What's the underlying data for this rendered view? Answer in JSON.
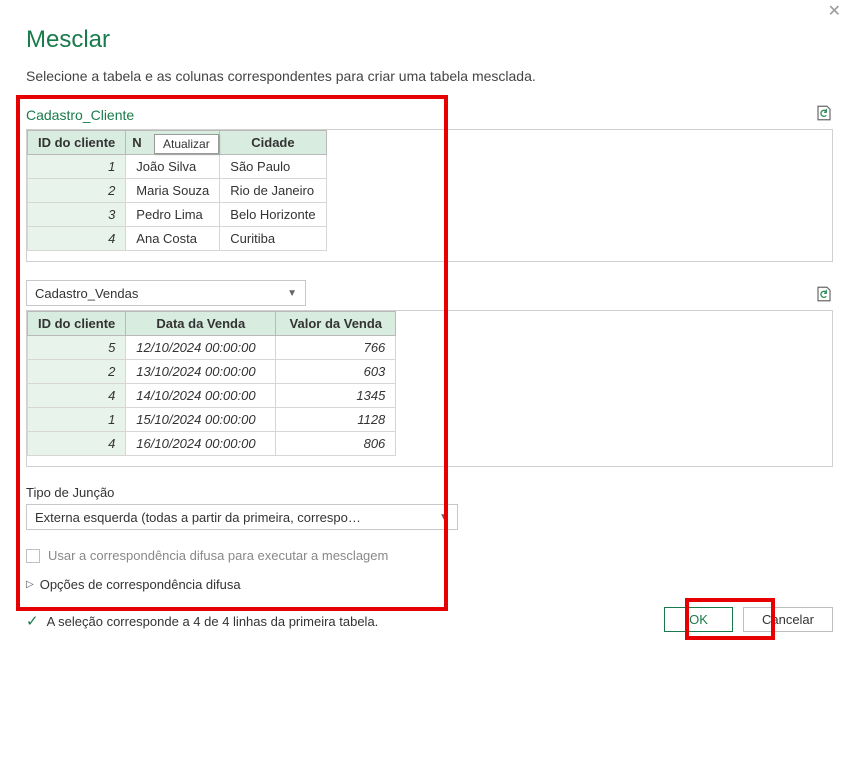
{
  "dialog": {
    "title": "Mesclar",
    "subtitle": "Selecione a tabela e as colunas correspondentes para criar uma tabela mesclada."
  },
  "tooltip": "Atualizar",
  "table1": {
    "name": "Cadastro_Cliente",
    "headers": [
      "ID do cliente",
      "N",
      "Cidade"
    ],
    "header_full_1": "Nome",
    "rows": [
      {
        "id": "1",
        "nome": "João Silva",
        "cidade": "São Paulo"
      },
      {
        "id": "2",
        "nome": "Maria Souza",
        "cidade": "Rio de Janeiro"
      },
      {
        "id": "3",
        "nome": "Pedro Lima",
        "cidade": "Belo Horizonte"
      },
      {
        "id": "4",
        "nome": "Ana Costa",
        "cidade": "Curitiba"
      }
    ]
  },
  "table2": {
    "name": "Cadastro_Vendas",
    "headers": [
      "ID do cliente",
      "Data da Venda",
      "Valor da Venda"
    ],
    "rows": [
      {
        "id": "5",
        "data": "12/10/2024 00:00:00",
        "valor": "766"
      },
      {
        "id": "2",
        "data": "13/10/2024 00:00:00",
        "valor": "603"
      },
      {
        "id": "4",
        "data": "14/10/2024 00:00:00",
        "valor": "1345"
      },
      {
        "id": "1",
        "data": "15/10/2024 00:00:00",
        "valor": "1128"
      },
      {
        "id": "4",
        "data": "16/10/2024 00:00:00",
        "valor": "806"
      }
    ]
  },
  "join": {
    "label": "Tipo de Junção",
    "selected": "Externa esquerda (todas a partir da primeira, correspo…"
  },
  "fuzzy": {
    "checkbox_label": "Usar a correspondência difusa para executar a mesclagem",
    "expander_label": "Opções de correspondência difusa"
  },
  "status": "A seleção corresponde a 4 de 4 linhas da primeira tabela.",
  "buttons": {
    "ok": "OK",
    "cancel": "Cancelar"
  }
}
